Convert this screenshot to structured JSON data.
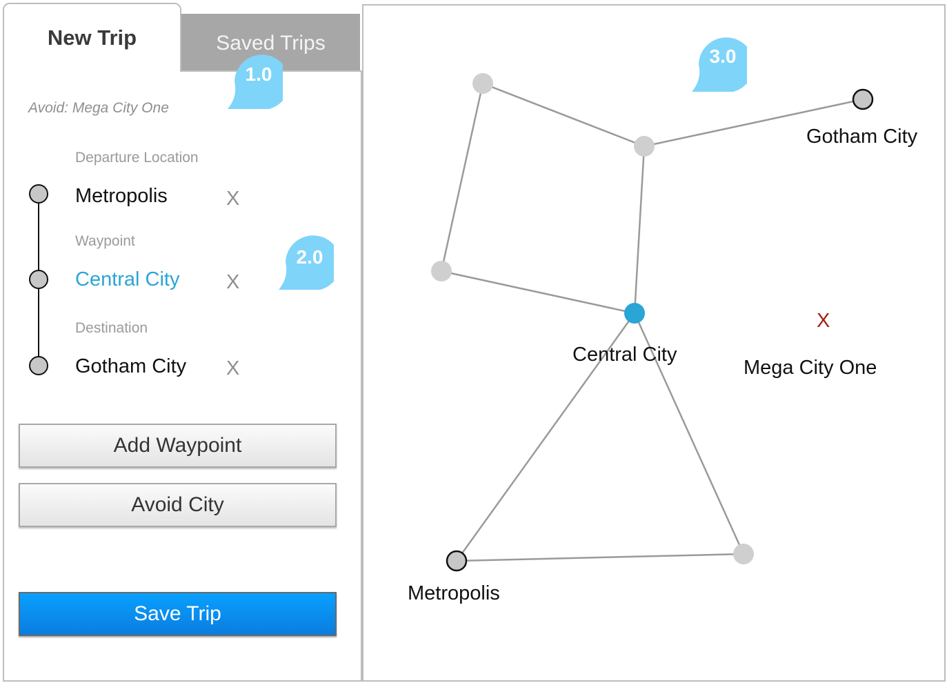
{
  "tabs": {
    "new_trip": "New Trip",
    "saved_trips": "Saved Trips"
  },
  "panel": {
    "avoid_text": "Avoid: Mega City One",
    "stops": [
      {
        "section": "Departure Location",
        "name": "Metropolis",
        "remove": "X",
        "active": false
      },
      {
        "section": "Waypoint",
        "name": "Central City",
        "remove": "X",
        "active": true
      },
      {
        "section": "Destination",
        "name": "Gotham City",
        "remove": "X",
        "active": false
      }
    ],
    "buttons": {
      "add_waypoint": "Add Waypoint",
      "avoid_city": "Avoid City",
      "save_trip": "Save Trip"
    }
  },
  "markers": {
    "m1": "1.0",
    "m2": "2.0",
    "m3": "3.0"
  },
  "map": {
    "labels": {
      "gotham": "Gotham City",
      "central": "Central City",
      "metropolis": "Metropolis",
      "mega": "Mega City One"
    },
    "avoid_mark": "X"
  },
  "colors": {
    "accent": "#29a6d6",
    "marker": "#7fd4f9",
    "node": "#cfcfcf",
    "edge": "#9a9a9a",
    "avoid": "#a31f10",
    "primary_button": "#0a8ef0"
  }
}
